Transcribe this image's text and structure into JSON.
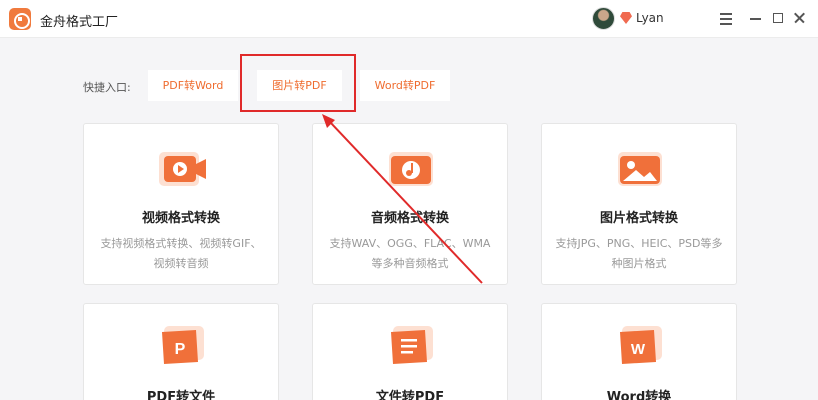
{
  "window": {
    "title": "金舟格式工厂",
    "user": "Lyan"
  },
  "quick_entry": {
    "label": "快捷入口:",
    "links": [
      "PDF转Word",
      "图片转PDF",
      "Word转PDF"
    ]
  },
  "cards": [
    {
      "title": "视频格式转换",
      "desc": "支持视频格式转换、视频转GIF、视频转音频",
      "icon": "video-camera-icon"
    },
    {
      "title": "音频格式转换",
      "desc": "支持WAV、OGG、FLAC、WMA等多种音频格式",
      "icon": "music-note-icon"
    },
    {
      "title": "图片格式转换",
      "desc": "支持JPG、PNG、HEIC、PSD等多种图片格式",
      "icon": "image-icon"
    },
    {
      "title": "PDF转文件",
      "icon": "pdf-icon"
    },
    {
      "title": "文件转PDF",
      "icon": "document-icon"
    },
    {
      "title": "Word转换",
      "icon": "word-icon"
    }
  ],
  "icon_glyphs": {
    "pdf": "P",
    "word": "W"
  },
  "colors": {
    "accent": "#ef6c2f",
    "highlight": "#e02a2a"
  }
}
